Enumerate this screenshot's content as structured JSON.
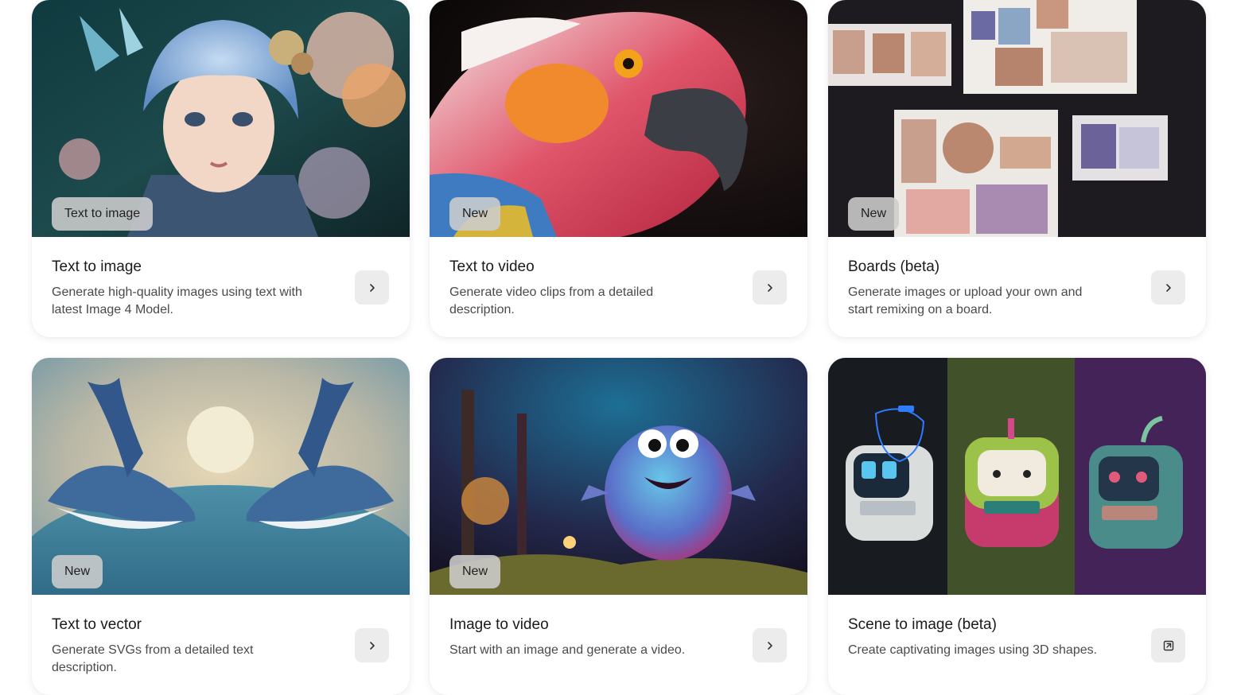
{
  "cards": [
    {
      "badge": "Text to image",
      "title": "Text to image",
      "description": "Generate high-quality images using text with latest Image 4 Model.",
      "button_icon": "chevron-right-icon"
    },
    {
      "badge": "New",
      "title": "Text to video",
      "description": "Generate video clips from a detailed description.",
      "button_icon": "chevron-right-icon"
    },
    {
      "badge": "New",
      "title": "Boards (beta)",
      "description": "Generate images or upload your own and start remixing on a board.",
      "button_icon": "chevron-right-icon"
    },
    {
      "badge": "New",
      "title": "Text to vector",
      "description": "Generate SVGs from a detailed text description.",
      "button_icon": "chevron-right-icon"
    },
    {
      "badge": "New",
      "title": "Image to video",
      "description": "Start with an image and generate a video.",
      "button_icon": "chevron-right-icon"
    },
    {
      "title": "Scene to image (beta)",
      "description": "Create captivating images using 3D shapes.",
      "button_icon": "external-link-icon"
    }
  ],
  "colors": {
    "card_background": "#ffffff",
    "badge_background": "#cdcdcd",
    "button_background": "#ececec",
    "title_text": "#1b1b1b",
    "description_text": "#4a4a4a"
  }
}
